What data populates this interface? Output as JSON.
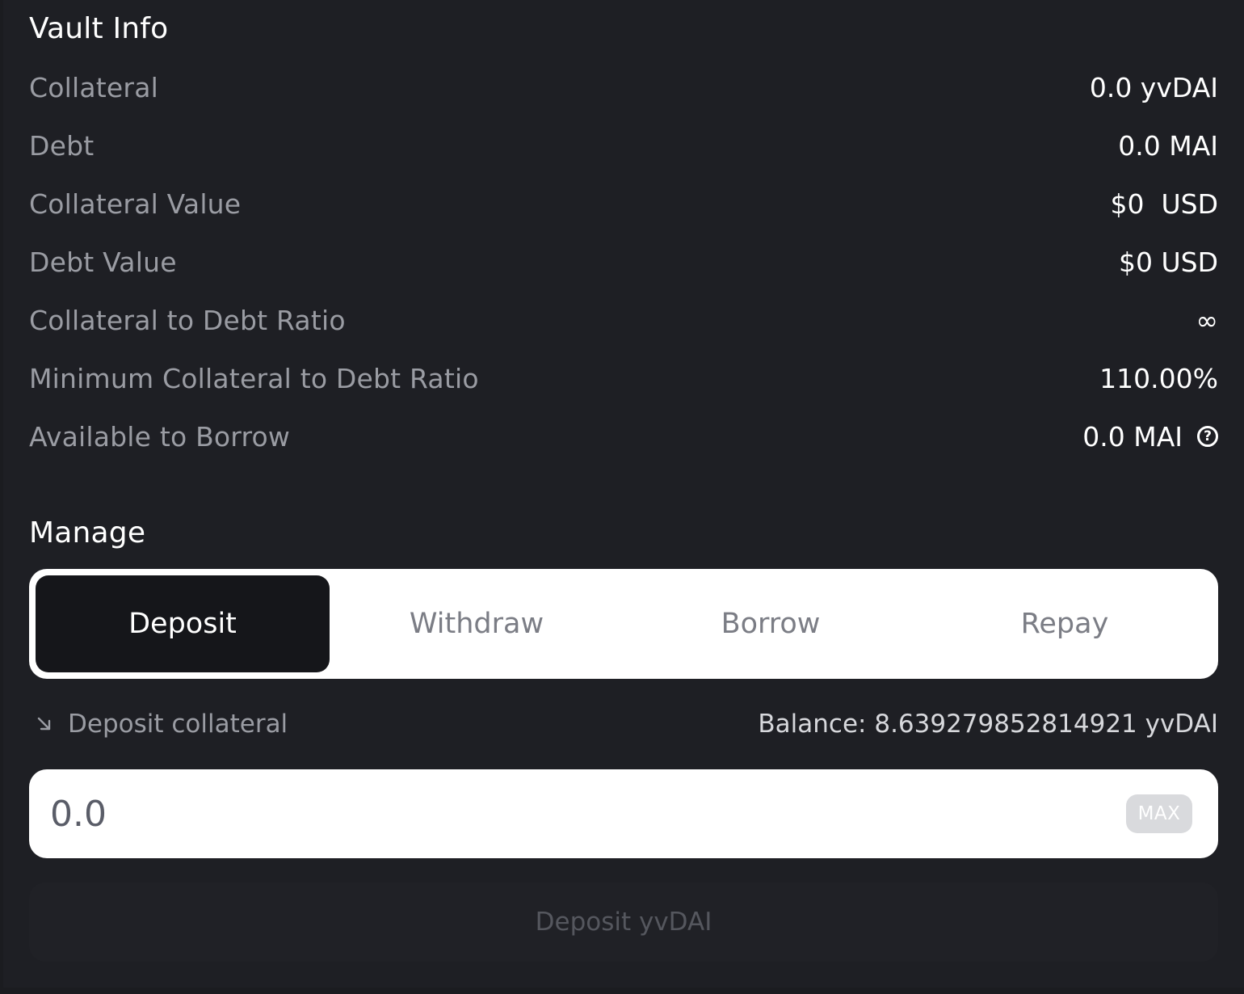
{
  "vault_info": {
    "title": "Vault Info",
    "rows": [
      {
        "label": "Collateral",
        "value": "0.0 yvDAI"
      },
      {
        "label": "Debt",
        "value": "0.0 MAI"
      },
      {
        "label": "Collateral Value",
        "value": "$0  USD"
      },
      {
        "label": "Debt Value",
        "value": "$0 USD"
      },
      {
        "label": "Collateral to Debt Ratio",
        "value": "∞"
      },
      {
        "label": "Minimum Collateral to Debt Ratio",
        "value": "110.00%"
      },
      {
        "label": "Available to Borrow",
        "value": "0.0 MAI",
        "icon": "help-icon"
      }
    ]
  },
  "manage": {
    "title": "Manage",
    "tabs": [
      {
        "label": "Deposit",
        "active": true
      },
      {
        "label": "Withdraw",
        "active": false
      },
      {
        "label": "Borrow",
        "active": false
      },
      {
        "label": "Repay",
        "active": false
      }
    ],
    "deposit_label": "Deposit collateral",
    "deposit_icon": "arrow-down-right-icon",
    "balance": "Balance: 8.639279852814921 yvDAI",
    "amount_placeholder": "0.0",
    "max_label": "MAX",
    "submit_label": "Deposit yvDAI"
  },
  "colors": {
    "background": "#1e1f24",
    "active_tab": "#15161a",
    "muted_text": "#9a9ca3"
  }
}
